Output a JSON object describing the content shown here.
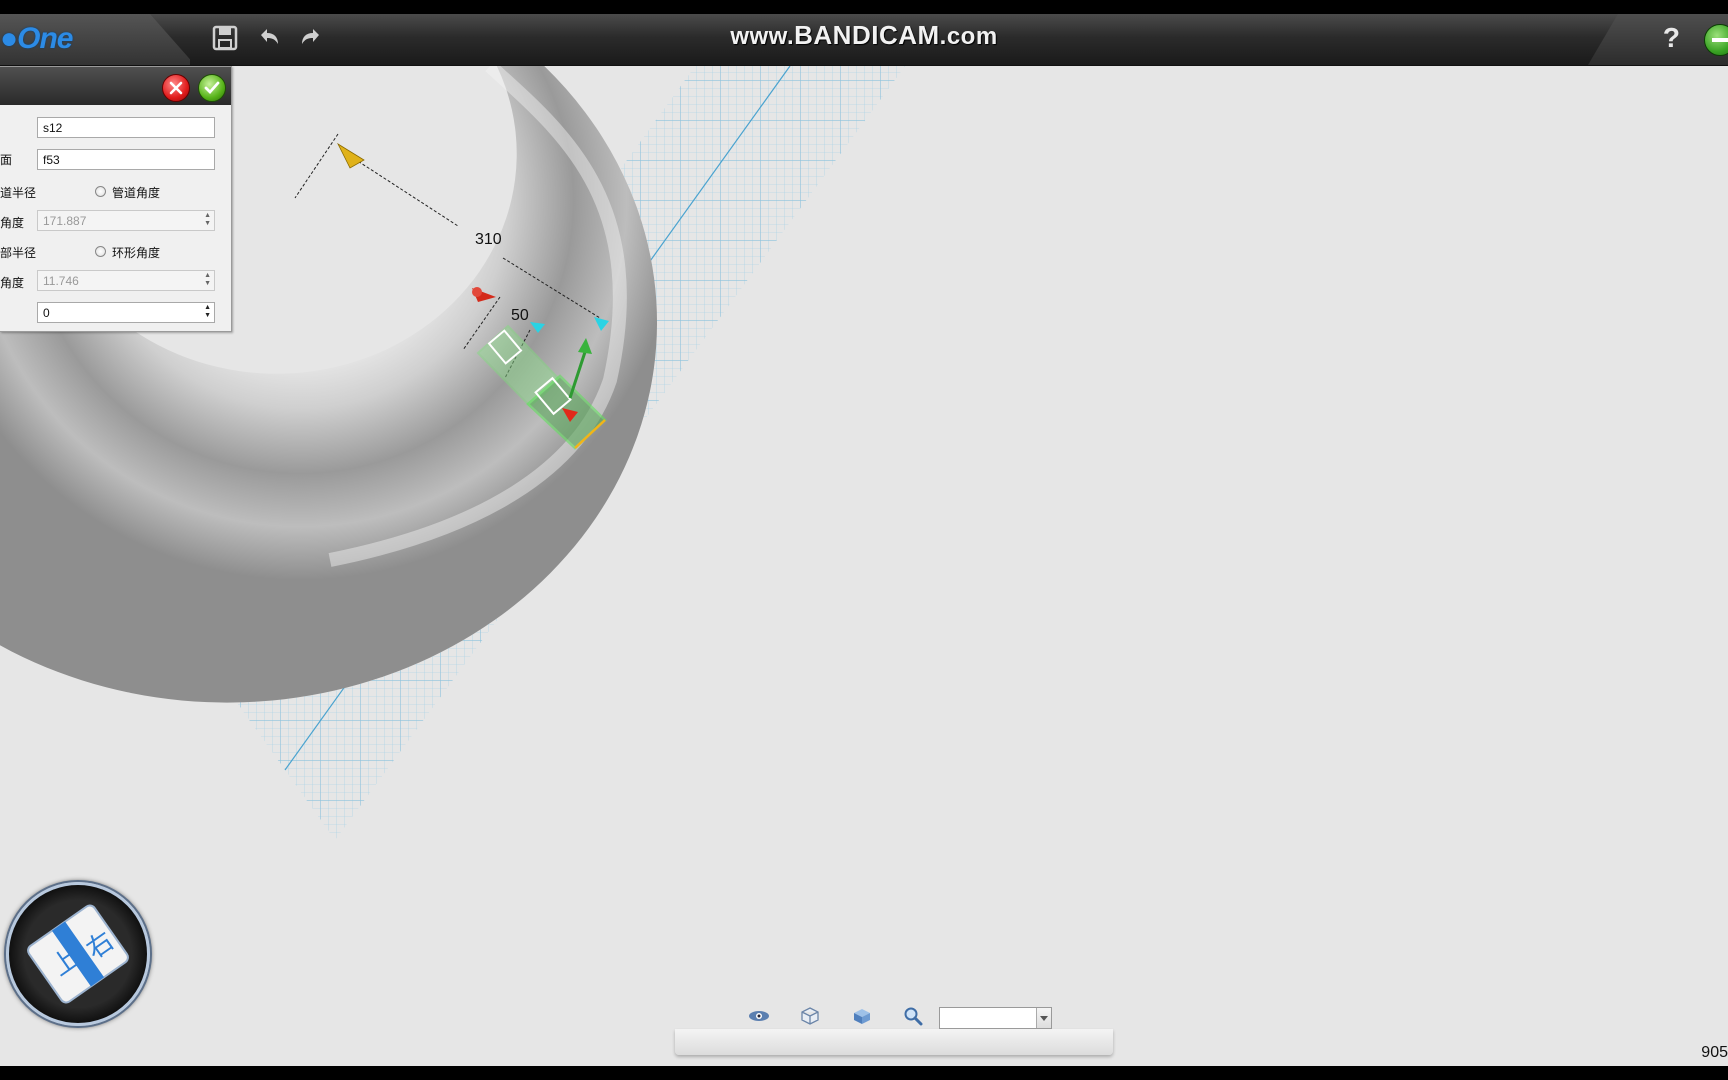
{
  "app": {
    "logo_text": "One",
    "watermark_prefix": "www.",
    "watermark_main": "BANDICAM",
    "watermark_suffix": ".com",
    "help_label": "?"
  },
  "toolbar": {
    "icons": [
      "save-icon",
      "undo-icon",
      "redo-icon"
    ]
  },
  "panel": {
    "fields": [
      {
        "label": "",
        "value": "s12"
      },
      {
        "label": "面",
        "value": "f53"
      }
    ],
    "radio1": {
      "left_label": "道半径",
      "right_label": "管道角度"
    },
    "angle1": {
      "label": "角度",
      "value": "171.887"
    },
    "radio2": {
      "left_label": "部半径",
      "right_label": "环形角度"
    },
    "angle2": {
      "label": "角度",
      "value": "11.746"
    },
    "offset": {
      "label": "",
      "value": "0"
    }
  },
  "viewport": {
    "dim_label_outer": "310",
    "dim_label_inner": "50",
    "viewcube_face_top": "上",
    "viewcube_face_right": "右"
  },
  "bottom_toolbar": {
    "icons": [
      "eye-icon",
      "wireframe-cube-icon",
      "solid-cube-icon",
      "zoom-icon"
    ],
    "zoom_value": ""
  },
  "status": {
    "number": "905"
  },
  "colors": {
    "grid": "#86c7e6",
    "logo": "#2c8be6",
    "background": "#e6e6e6"
  }
}
